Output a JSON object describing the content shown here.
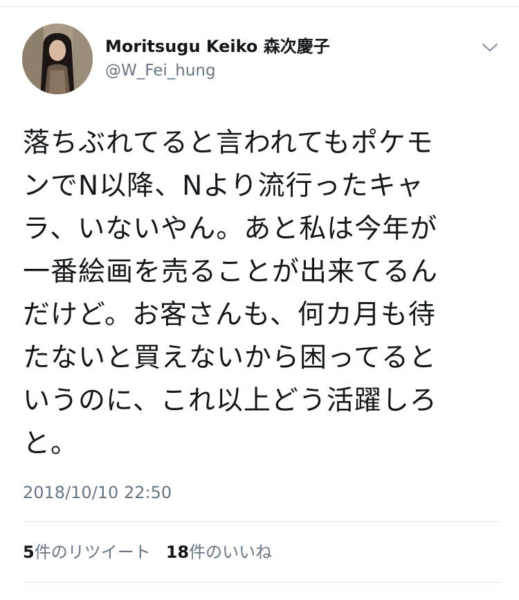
{
  "tweet": {
    "display_name": "Moritsugu Keiko 森次慶子",
    "handle": "@W_Fei_hung",
    "text_lines": [
      "落ちぶれてると言われてもポケモ",
      "ンでN以降、Nより流行ったキャ",
      "ラ、いないやん。あと私は今年が",
      "一番絵画を売ることが出来てるん",
      "だけど。お客さんも、何カ月も待",
      "たないと買えないから困ってると",
      "いうのに、これ以上どう活躍しろ",
      "と。"
    ],
    "timestamp": "2018/10/10 22:50",
    "retweets": {
      "count": "5",
      "label": "件のリツイート"
    },
    "likes": {
      "count": "18",
      "label": "件のいいね"
    }
  },
  "icons": {
    "menu": "chevron-down-icon",
    "avatar": "profile-photo"
  },
  "colors": {
    "primary_text": "#14171a",
    "secondary_text": "#657786",
    "divider": "#e1e8ed"
  }
}
